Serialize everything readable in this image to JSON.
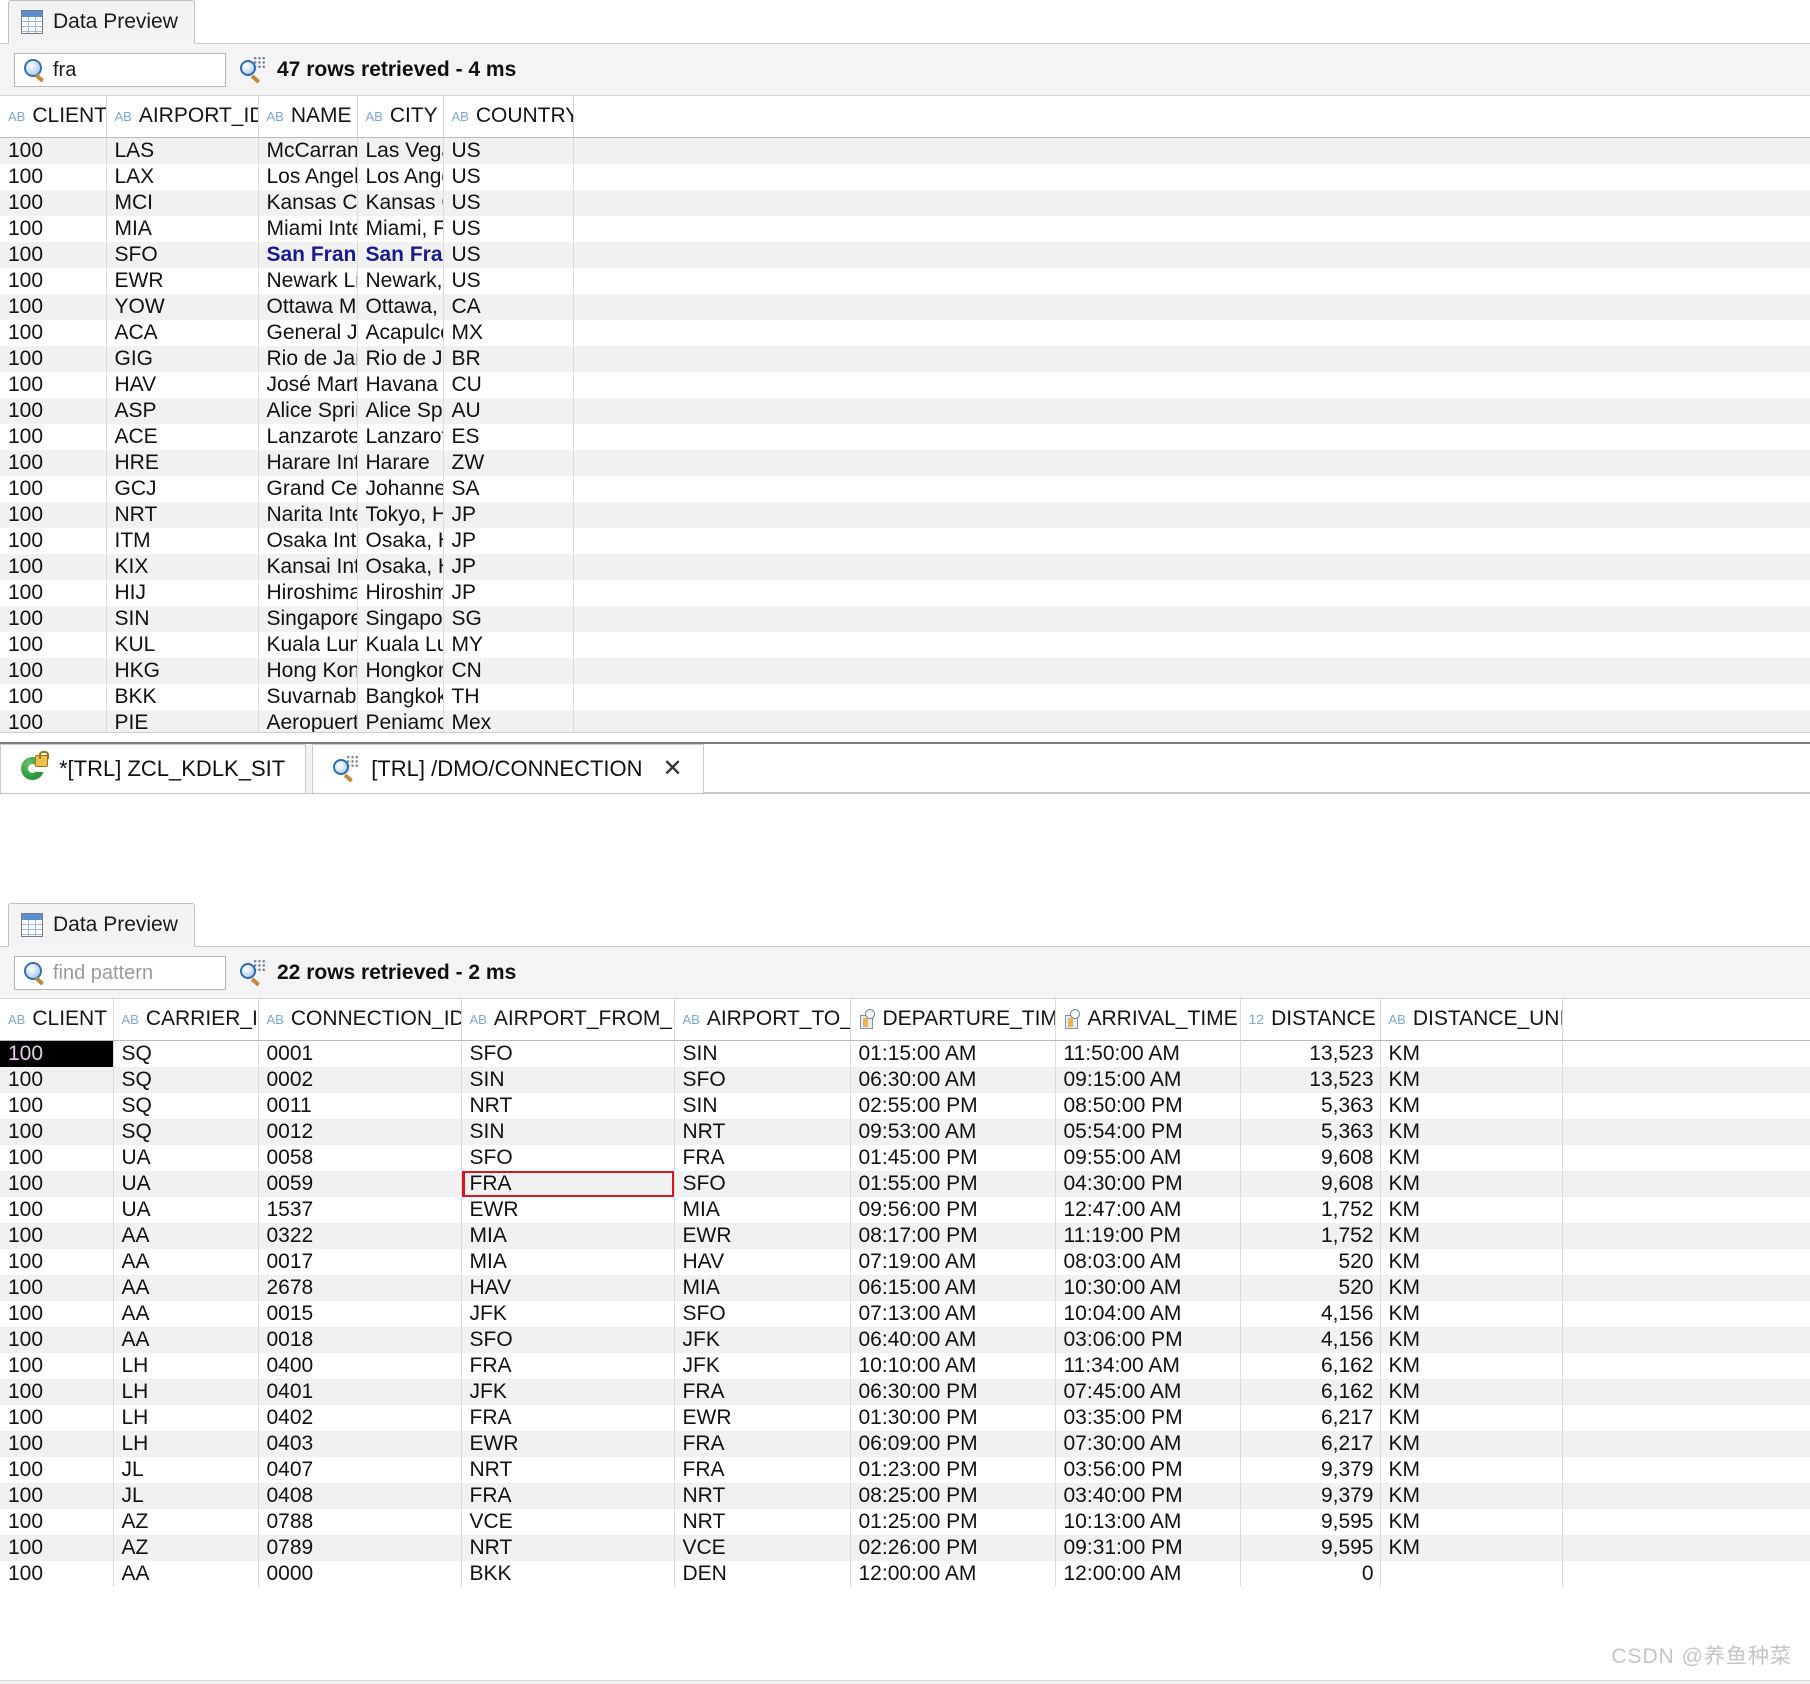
{
  "upper_panel": {
    "tab": {
      "label": "Data Preview",
      "icon": "grid-table-icon"
    },
    "search": {
      "value": "fra",
      "placeholder": "find pattern",
      "icon": "magnifier-icon"
    },
    "status": {
      "text": "47 rows retrieved - 4 ms",
      "icon": "query-result-icon"
    },
    "columns": [
      {
        "name": "CLIENT",
        "type_badge": "AB",
        "type": "string"
      },
      {
        "name": "AIRPORT_ID",
        "type_badge": "AB",
        "type": "string"
      },
      {
        "name": "NAME",
        "type_badge": "AB",
        "type": "string"
      },
      {
        "name": "CITY",
        "type_badge": "AB",
        "type": "string"
      },
      {
        "name": "COUNTRY",
        "type_badge": "AB",
        "type": "string"
      }
    ],
    "clipped_top_row": [
      "100",
      "LAS",
      "McCarran",
      "Las Vega",
      "US"
    ],
    "rows": [
      [
        "100",
        "LAX",
        "Los Angel",
        "Los Ange",
        "US"
      ],
      [
        "100",
        "MCI",
        "Kansas Ci",
        "Kansas C",
        "US"
      ],
      [
        "100",
        "MIA",
        "Miami Inte",
        "Miami, F",
        "US"
      ],
      [
        "100",
        "SFO",
        "San Franc",
        "San Fran",
        "US"
      ],
      [
        "100",
        "EWR",
        "Newark Li",
        "Newark,",
        "US"
      ],
      [
        "100",
        "YOW",
        "Ottawa Ma",
        "Ottawa,",
        "CA"
      ],
      [
        "100",
        "ACA",
        "General Ju",
        "Acapulco",
        "MX"
      ],
      [
        "100",
        "GIG",
        "Rio de Jar",
        "Rio de Ja",
        "BR"
      ],
      [
        "100",
        "HAV",
        "José Mart",
        "Havana",
        "CU"
      ],
      [
        "100",
        "ASP",
        "Alice Sprin",
        "Alice Spr",
        "AU"
      ],
      [
        "100",
        "ACE",
        "Lanzarote",
        "Lanzarot",
        "ES"
      ],
      [
        "100",
        "HRE",
        "Harare Int",
        "Harare",
        "ZW"
      ],
      [
        "100",
        "GCJ",
        "Grand Cen",
        "Johanne",
        "SA"
      ],
      [
        "100",
        "NRT",
        "Narita Inte",
        "Tokyo, H",
        "JP"
      ],
      [
        "100",
        "ITM",
        "Osaka Inte",
        "Osaka, H",
        "JP"
      ],
      [
        "100",
        "KIX",
        "Kansai Int",
        "Osaka, H",
        "JP"
      ],
      [
        "100",
        "HIJ",
        "Hiroshima",
        "Hiroshim",
        "JP"
      ],
      [
        "100",
        "SIN",
        "Singapore",
        "Singapor",
        "SG"
      ],
      [
        "100",
        "KUL",
        "Kuala Lum",
        "Kuala Lu",
        "MY"
      ],
      [
        "100",
        "HKG",
        "Hong Kon",
        "Hongkon",
        "CN"
      ],
      [
        "100",
        "BKK",
        "Suvarnabh",
        "Bangkok",
        "TH"
      ],
      [
        "100",
        "PIE",
        "Aeropuert",
        "Peniamo",
        "Mex"
      ]
    ],
    "highlighted_row_index": 3
  },
  "editor_tabs": [
    {
      "label": "*[TRL] ZCL_KDLK_SIT",
      "icon": "abap-class-locked-icon",
      "closable": false,
      "active": false
    },
    {
      "label": "[TRL] /DMO/CONNECTION",
      "icon": "cds-view-icon",
      "closable": true,
      "close_label": "✕",
      "active": true
    }
  ],
  "lower_panel": {
    "tab": {
      "label": "Data Preview",
      "icon": "grid-table-icon"
    },
    "search": {
      "value": "",
      "placeholder": "find pattern",
      "icon": "magnifier-icon"
    },
    "status": {
      "text": "22 rows retrieved - 2 ms",
      "icon": "query-result-icon"
    },
    "columns": [
      {
        "name": "CLIENT",
        "type_badge": "AB",
        "type": "string"
      },
      {
        "name": "CARRIER_ID",
        "type_badge": "AB",
        "type": "string"
      },
      {
        "name": "CONNECTION_ID",
        "type_badge": "AB",
        "type": "string"
      },
      {
        "name": "AIRPORT_FROM_ID",
        "type_badge": "AB",
        "type": "string"
      },
      {
        "name": "AIRPORT_TO_ID",
        "type_badge": "AB",
        "type": "string"
      },
      {
        "name": "DEPARTURE_TIME",
        "type_badge": "clock",
        "type": "time"
      },
      {
        "name": "ARRIVAL_TIME",
        "type_badge": "clock",
        "type": "time"
      },
      {
        "name": "DISTANCE",
        "type_badge": "12",
        "type": "number"
      },
      {
        "name": "DISTANCE_UNIT",
        "type_badge": "AB",
        "type": "string"
      }
    ],
    "rows": [
      [
        "100",
        "SQ",
        "0001",
        "SFO",
        "SIN",
        "01:15:00 AM",
        "11:50:00 AM",
        "13,523",
        "KM"
      ],
      [
        "100",
        "SQ",
        "0002",
        "SIN",
        "SFO",
        "06:30:00 AM",
        "09:15:00 AM",
        "13,523",
        "KM"
      ],
      [
        "100",
        "SQ",
        "0011",
        "NRT",
        "SIN",
        "02:55:00 PM",
        "08:50:00 PM",
        "5,363",
        "KM"
      ],
      [
        "100",
        "SQ",
        "0012",
        "SIN",
        "NRT",
        "09:53:00 AM",
        "05:54:00 PM",
        "5,363",
        "KM"
      ],
      [
        "100",
        "UA",
        "0058",
        "SFO",
        "FRA",
        "01:45:00 PM",
        "09:55:00 AM",
        "9,608",
        "KM"
      ],
      [
        "100",
        "UA",
        "0059",
        "FRA",
        "SFO",
        "01:55:00 PM",
        "04:30:00 PM",
        "9,608",
        "KM"
      ],
      [
        "100",
        "UA",
        "1537",
        "EWR",
        "MIA",
        "09:56:00 PM",
        "12:47:00 AM",
        "1,752",
        "KM"
      ],
      [
        "100",
        "AA",
        "0322",
        "MIA",
        "EWR",
        "08:17:00 PM",
        "11:19:00 PM",
        "1,752",
        "KM"
      ],
      [
        "100",
        "AA",
        "0017",
        "MIA",
        "HAV",
        "07:19:00 AM",
        "08:03:00 AM",
        "520",
        "KM"
      ],
      [
        "100",
        "AA",
        "2678",
        "HAV",
        "MIA",
        "06:15:00 AM",
        "10:30:00 AM",
        "520",
        "KM"
      ],
      [
        "100",
        "AA",
        "0015",
        "JFK",
        "SFO",
        "07:13:00 AM",
        "10:04:00 AM",
        "4,156",
        "KM"
      ],
      [
        "100",
        "AA",
        "0018",
        "SFO",
        "JFK",
        "06:40:00 AM",
        "03:06:00 PM",
        "4,156",
        "KM"
      ],
      [
        "100",
        "LH",
        "0400",
        "FRA",
        "JFK",
        "10:10:00 AM",
        "11:34:00 AM",
        "6,162",
        "KM"
      ],
      [
        "100",
        "LH",
        "0401",
        "JFK",
        "FRA",
        "06:30:00 PM",
        "07:45:00 AM",
        "6,162",
        "KM"
      ],
      [
        "100",
        "LH",
        "0402",
        "FRA",
        "EWR",
        "01:30:00 PM",
        "03:35:00 PM",
        "6,217",
        "KM"
      ],
      [
        "100",
        "LH",
        "0403",
        "EWR",
        "FRA",
        "06:09:00 PM",
        "07:30:00 AM",
        "6,217",
        "KM"
      ],
      [
        "100",
        "JL",
        "0407",
        "NRT",
        "FRA",
        "01:23:00 PM",
        "03:56:00 PM",
        "9,379",
        "KM"
      ],
      [
        "100",
        "JL",
        "0408",
        "FRA",
        "NRT",
        "08:25:00 PM",
        "03:40:00 PM",
        "9,379",
        "KM"
      ],
      [
        "100",
        "AZ",
        "0788",
        "VCE",
        "NRT",
        "01:25:00 PM",
        "10:13:00 AM",
        "9,595",
        "KM"
      ],
      [
        "100",
        "AZ",
        "0789",
        "NRT",
        "VCE",
        "02:26:00 PM",
        "09:31:00 PM",
        "9,595",
        "KM"
      ],
      [
        "100",
        "AA",
        "0000",
        "BKK",
        "DEN",
        "12:00:00 AM",
        "12:00:00 AM",
        "0",
        ""
      ]
    ],
    "selected_cell": {
      "row": 0,
      "col": 0
    },
    "marked_cell": {
      "row": 5,
      "col": 3,
      "outline_color": "#d61921"
    }
  },
  "watermark": {
    "text": "CSDN @养鱼种菜"
  },
  "colors": {
    "selection_bg": "#000000",
    "selection_fg": "#e8c9ee",
    "link_text": "#1a1a8c",
    "row_stripe": "#f1f1f1",
    "accent_outline": "#d61921"
  }
}
